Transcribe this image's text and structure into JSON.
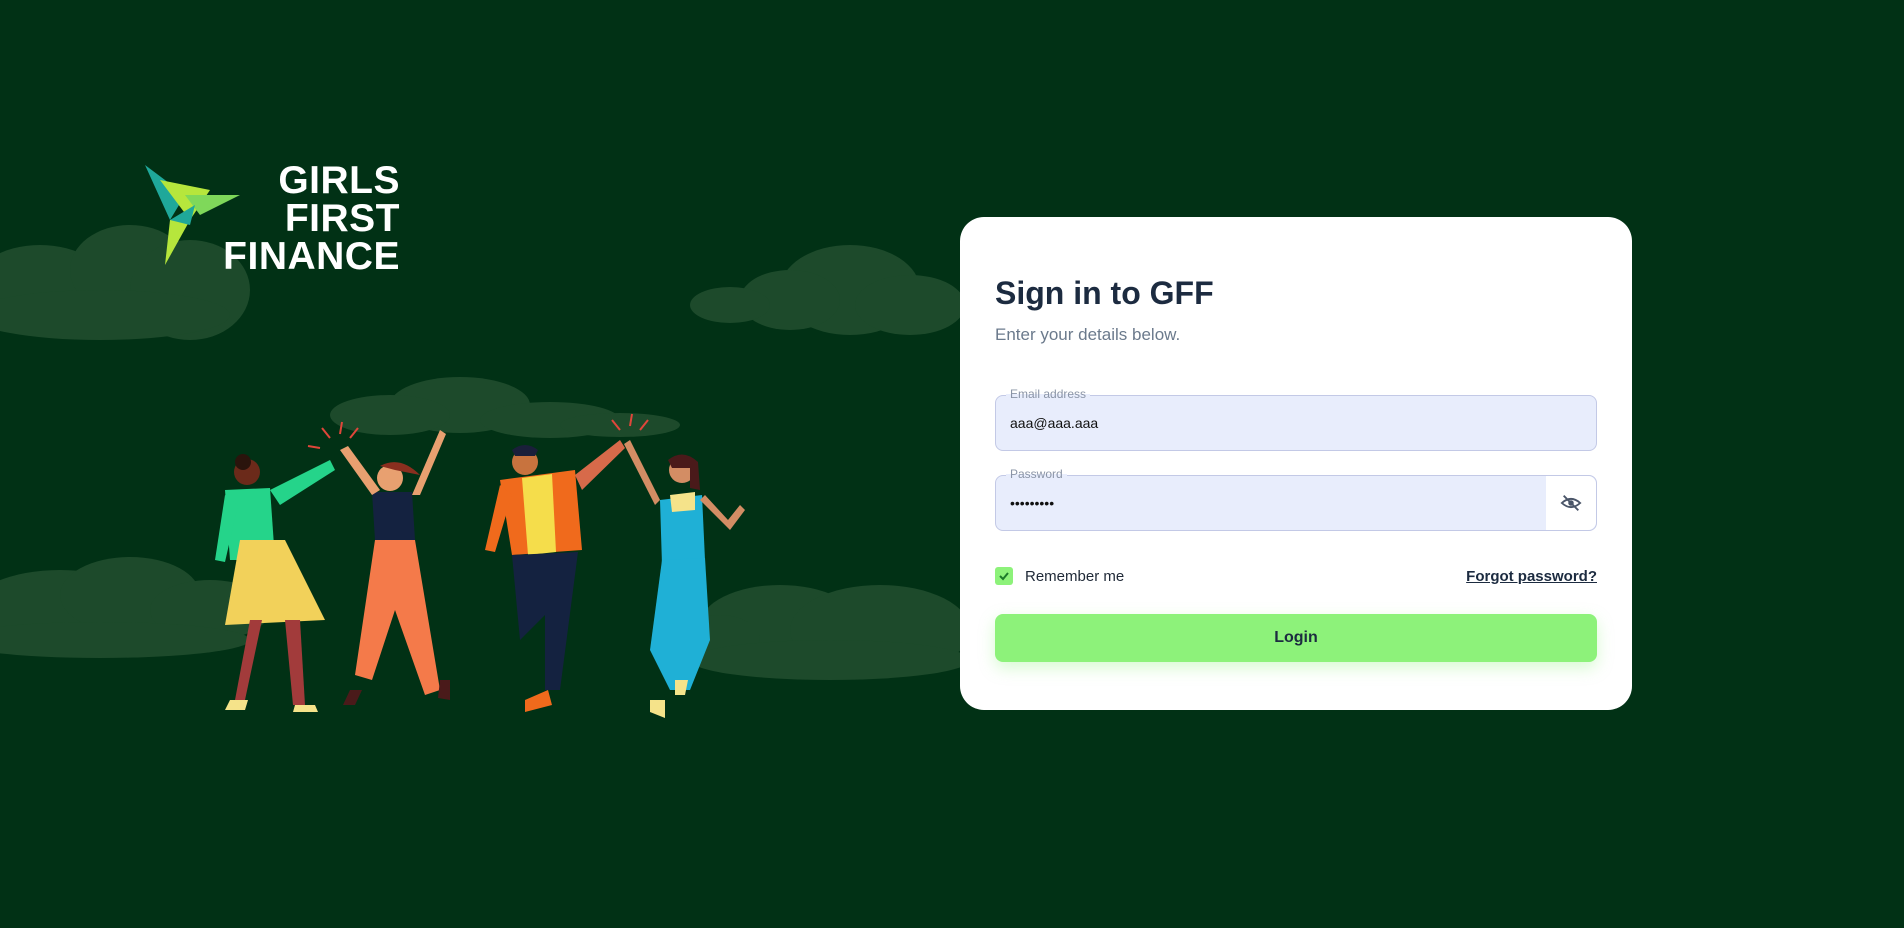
{
  "brand": {
    "logo_lines": [
      "GIRLS",
      "FIRST",
      "FINANCE"
    ],
    "colors": {
      "background": "#013115",
      "accent": "#8df27a",
      "bird_teal": "#1fa89a",
      "bird_lime": "#b6e63c"
    }
  },
  "illustration": {
    "icon": "people-high-five-illustration"
  },
  "login_card": {
    "title": "Sign in to GFF",
    "subtitle": "Enter your details below.",
    "email": {
      "label": "Email address",
      "value": "aaa@aaa.aaa"
    },
    "password": {
      "label": "Password",
      "value": "•••••••••",
      "toggle_icon": "eye-off-icon"
    },
    "remember_label": "Remember me",
    "remember_checked": true,
    "forgot_label": "Forgot password?",
    "login_label": "Login"
  }
}
